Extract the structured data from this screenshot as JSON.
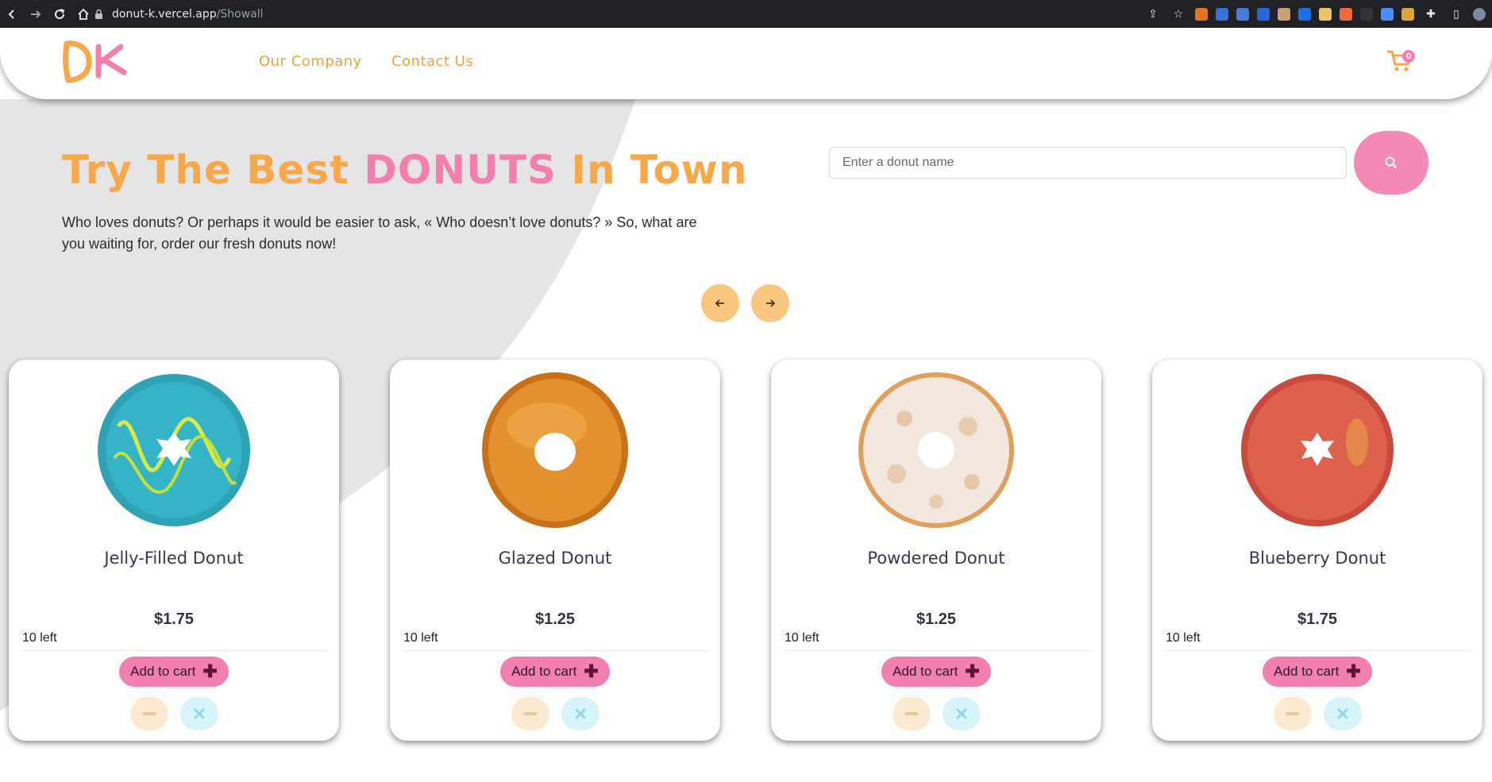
{
  "browser": {
    "url_host": "donut-k.vercel.app",
    "url_path": "/Showall"
  },
  "header": {
    "logo_text": "DK",
    "nav": [
      "Our Company",
      "Contact Us"
    ],
    "cart_count": "0"
  },
  "hero": {
    "title_before": "Try The Best ",
    "title_highlight": "DONUTS",
    "title_after": " In Town",
    "description": "Who loves donuts? Or perhaps it would be easier to ask, « Who doesn’t love donuts? » So, what are you waiting for, order our fresh donuts now!"
  },
  "search": {
    "placeholder": "Enter a donut name"
  },
  "products": [
    {
      "name": "Jelly-Filled Donut",
      "price": "$1.75",
      "stock": "10 left",
      "add_label": "Add to cart",
      "icon": "blue-donut-image"
    },
    {
      "name": "Glazed Donut",
      "price": "$1.25",
      "stock": "10 left",
      "add_label": "Add to cart",
      "icon": "glazed-donut-image"
    },
    {
      "name": "Powdered Donut",
      "price": "$1.25",
      "stock": "10 left",
      "add_label": "Add to cart",
      "icon": "powdered-donut-image"
    },
    {
      "name": "Blueberry Donut",
      "price": "$1.75",
      "stock": "10 left",
      "add_label": "Add to cart",
      "icon": "pink-donut-image"
    }
  ],
  "colors": {
    "accent_orange": "#f6a84a",
    "accent_pink": "#f27fb0",
    "arrow_bg": "#f8c77f",
    "minus_bg": "#fde9cf",
    "remove_bg": "#d6f4fa"
  }
}
